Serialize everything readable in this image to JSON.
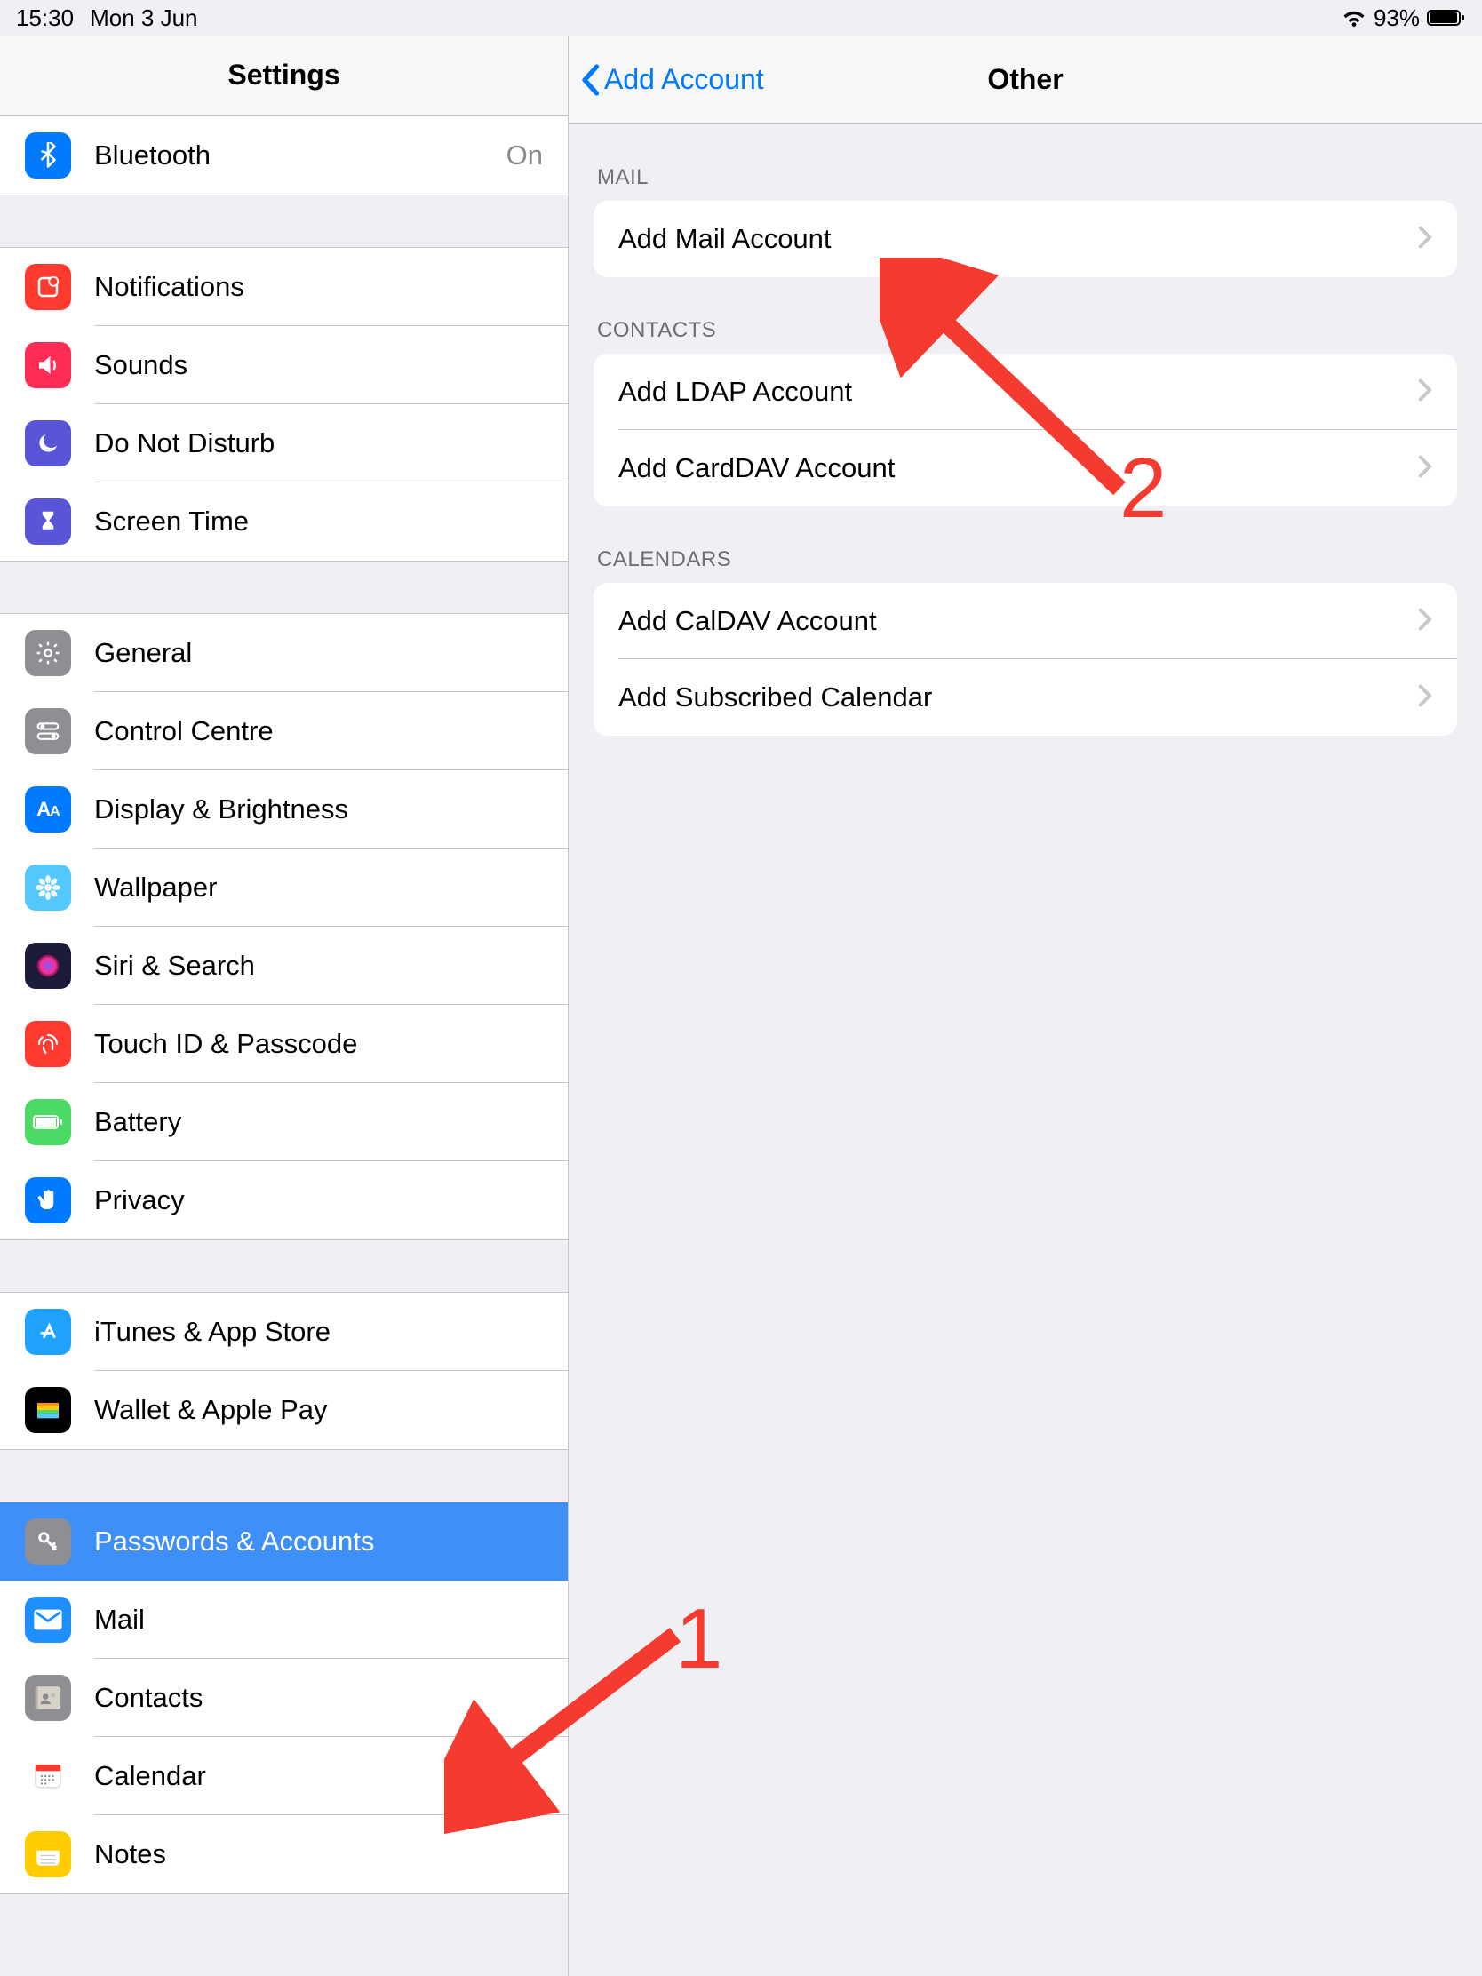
{
  "status": {
    "time": "15:30",
    "date": "Mon 3 Jun",
    "battery_pct": "93%"
  },
  "sidebar": {
    "title": "Settings",
    "groups": [
      {
        "items": [
          {
            "id": "bluetooth",
            "label": "Bluetooth",
            "value": "On",
            "icon_bg": "#007aff",
            "icon": "bluetooth"
          }
        ]
      },
      {
        "items": [
          {
            "id": "notifications",
            "label": "Notifications",
            "icon_bg": "#ff3b30",
            "icon": "notifications"
          },
          {
            "id": "sounds",
            "label": "Sounds",
            "icon_bg": "#ff2d55",
            "icon": "sounds"
          },
          {
            "id": "dnd",
            "label": "Do Not Disturb",
            "icon_bg": "#5856d6",
            "icon": "moon"
          },
          {
            "id": "screentime",
            "label": "Screen Time",
            "icon_bg": "#5856d6",
            "icon": "hourglass"
          }
        ]
      },
      {
        "items": [
          {
            "id": "general",
            "label": "General",
            "icon_bg": "#8e8e93",
            "icon": "gear"
          },
          {
            "id": "control-centre",
            "label": "Control Centre",
            "icon_bg": "#8e8e93",
            "icon": "toggles"
          },
          {
            "id": "display",
            "label": "Display & Brightness",
            "icon_bg": "#007aff",
            "icon": "aa"
          },
          {
            "id": "wallpaper",
            "label": "Wallpaper",
            "icon_bg": "#54c7fc",
            "icon": "flower"
          },
          {
            "id": "siri",
            "label": "Siri & Search",
            "icon_bg": "#1b1b3a",
            "icon": "siri"
          },
          {
            "id": "touchid",
            "label": "Touch ID & Passcode",
            "icon_bg": "#ff3b30",
            "icon": "fingerprint"
          },
          {
            "id": "battery",
            "label": "Battery",
            "icon_bg": "#4cd964",
            "icon": "battery"
          },
          {
            "id": "privacy",
            "label": "Privacy",
            "icon_bg": "#007aff",
            "icon": "hand"
          }
        ]
      },
      {
        "items": [
          {
            "id": "itunes",
            "label": "iTunes & App Store",
            "icon_bg": "#1fa2ff",
            "icon": "appstore"
          },
          {
            "id": "wallet",
            "label": "Wallet & Apple Pay",
            "icon_bg": "#000000",
            "icon": "wallet"
          }
        ]
      },
      {
        "items": [
          {
            "id": "passwords",
            "label": "Passwords & Accounts",
            "icon_bg": "#8e8e93",
            "icon": "key",
            "selected": true
          },
          {
            "id": "mail",
            "label": "Mail",
            "icon_bg": "#1f8fff",
            "icon": "mail"
          },
          {
            "id": "contacts",
            "label": "Contacts",
            "icon_bg": "#8e8e93",
            "icon": "contacts"
          },
          {
            "id": "calendar",
            "label": "Calendar",
            "icon_bg": "#ffffff",
            "icon": "calendar"
          },
          {
            "id": "notes",
            "label": "Notes",
            "icon_bg": "#ffcc00",
            "icon": "notes"
          }
        ]
      }
    ]
  },
  "detail": {
    "back_label": "Add Account",
    "title": "Other",
    "sections": [
      {
        "header": "MAIL",
        "rows": [
          {
            "label": "Add Mail Account"
          }
        ]
      },
      {
        "header": "CONTACTS",
        "rows": [
          {
            "label": "Add LDAP Account"
          },
          {
            "label": "Add CardDAV Account"
          }
        ]
      },
      {
        "header": "CALENDARS",
        "rows": [
          {
            "label": "Add CalDAV Account"
          },
          {
            "label": "Add Subscribed Calendar"
          }
        ]
      }
    ]
  },
  "annotations": {
    "label1": "1",
    "label2": "2"
  }
}
